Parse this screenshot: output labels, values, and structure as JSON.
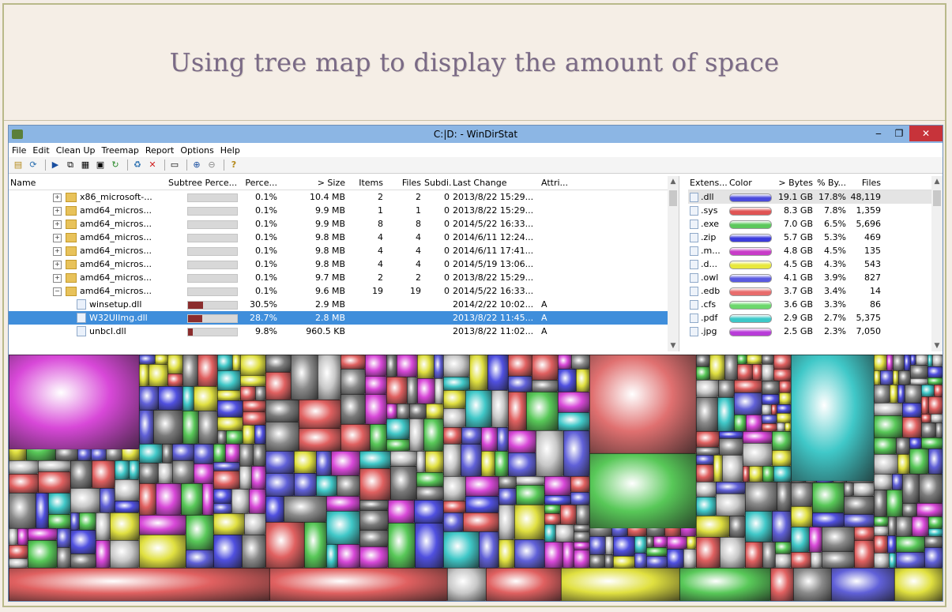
{
  "banner": {
    "title": "Using tree map to display the amount of space"
  },
  "window": {
    "title": "C:|D: - WinDirStat"
  },
  "menu": [
    "File",
    "Edit",
    "Clean Up",
    "Treemap",
    "Report",
    "Options",
    "Help"
  ],
  "tree": {
    "columns": [
      "Name",
      "Subtree Perce...",
      "Perce...",
      "> Size",
      "Items",
      "Files",
      "Subdi...",
      "Last Change",
      "Attri..."
    ],
    "rows": [
      {
        "name": "x86_microsoft-...",
        "pct": "0.1%",
        "size": "10.4 MB",
        "items": "2",
        "files": "2",
        "subdirs": "0",
        "last": "2013/8/22 15:29...",
        "attr": "",
        "type": "folder",
        "fill": 0.0
      },
      {
        "name": "amd64_micros...",
        "pct": "0.1%",
        "size": "9.9 MB",
        "items": "1",
        "files": "1",
        "subdirs": "0",
        "last": "2013/8/22 15:29...",
        "attr": "",
        "type": "folder",
        "fill": 0.0
      },
      {
        "name": "amd64_micros...",
        "pct": "0.1%",
        "size": "9.9 MB",
        "items": "8",
        "files": "8",
        "subdirs": "0",
        "last": "2014/5/22 16:33...",
        "attr": "",
        "type": "folder",
        "fill": 0.0
      },
      {
        "name": "amd64_micros...",
        "pct": "0.1%",
        "size": "9.8 MB",
        "items": "4",
        "files": "4",
        "subdirs": "0",
        "last": "2014/6/11 12:24...",
        "attr": "",
        "type": "folder",
        "fill": 0.0
      },
      {
        "name": "amd64_micros...",
        "pct": "0.1%",
        "size": "9.8 MB",
        "items": "4",
        "files": "4",
        "subdirs": "0",
        "last": "2014/6/11 17:41...",
        "attr": "",
        "type": "folder",
        "fill": 0.0
      },
      {
        "name": "amd64_micros...",
        "pct": "0.1%",
        "size": "9.8 MB",
        "items": "4",
        "files": "4",
        "subdirs": "0",
        "last": "2014/5/19 13:06...",
        "attr": "",
        "type": "folder",
        "fill": 0.0
      },
      {
        "name": "amd64_micros...",
        "pct": "0.1%",
        "size": "9.7 MB",
        "items": "2",
        "files": "2",
        "subdirs": "0",
        "last": "2013/8/22 15:29...",
        "attr": "",
        "type": "folder",
        "fill": 0.0
      },
      {
        "name": "amd64_micros...",
        "pct": "0.1%",
        "size": "9.6 MB",
        "items": "19",
        "files": "19",
        "subdirs": "0",
        "last": "2014/5/22 16:33...",
        "attr": "",
        "type": "folder",
        "fill": 0.0
      },
      {
        "name": "winsetup.dll",
        "pct": "30.5%",
        "size": "2.9 MB",
        "items": "",
        "files": "",
        "subdirs": "",
        "last": "2014/2/22 10:02...",
        "attr": "A",
        "type": "file",
        "fill": 0.305
      },
      {
        "name": "W32UIImg.dll",
        "pct": "28.7%",
        "size": "2.8 MB",
        "items": "",
        "files": "",
        "subdirs": "",
        "last": "2013/8/22 11:45...",
        "attr": "A",
        "type": "file",
        "fill": 0.287
      },
      {
        "name": "unbcl.dll",
        "pct": "9.8%",
        "size": "960.5 KB",
        "items": "",
        "files": "",
        "subdirs": "",
        "last": "2013/8/22 11:02...",
        "attr": "A",
        "type": "file",
        "fill": 0.098
      }
    ]
  },
  "extensions": {
    "columns": [
      "Extens...",
      "Color",
      "> Bytes",
      "% By...",
      "Files"
    ],
    "rows": [
      {
        "ext": ".dll",
        "color": "#4a4adc",
        "bytes": "19.1 GB",
        "pct": "17.8%",
        "files": "48,119"
      },
      {
        "ext": ".sys",
        "color": "#e05454",
        "bytes": "8.3 GB",
        "pct": "7.8%",
        "files": "1,359"
      },
      {
        "ext": ".exe",
        "color": "#5cc85c",
        "bytes": "7.0 GB",
        "pct": "6.5%",
        "files": "5,696"
      },
      {
        "ext": ".zip",
        "color": "#3c3cdc",
        "bytes": "5.7 GB",
        "pct": "5.3%",
        "files": "469"
      },
      {
        "ext": ".m...",
        "color": "#c83cc8",
        "bytes": "4.8 GB",
        "pct": "4.5%",
        "files": "135"
      },
      {
        "ext": ".d...",
        "color": "#e8e83c",
        "bytes": "4.5 GB",
        "pct": "4.3%",
        "files": "543"
      },
      {
        "ext": ".owl",
        "color": "#5a5ae0",
        "bytes": "4.1 GB",
        "pct": "3.9%",
        "files": "827"
      },
      {
        "ext": ".edb",
        "color": "#e86c6c",
        "bytes": "3.7 GB",
        "pct": "3.4%",
        "files": "14"
      },
      {
        "ext": ".cfs",
        "color": "#6cd86c",
        "bytes": "3.6 GB",
        "pct": "3.3%",
        "files": "86"
      },
      {
        "ext": ".pdf",
        "color": "#3cc8c8",
        "bytes": "2.9 GB",
        "pct": "2.7%",
        "files": "5,375"
      },
      {
        "ext": ".jpg",
        "color": "#b83cd8",
        "bytes": "2.5 GB",
        "pct": "2.3%",
        "files": "7,050"
      }
    ]
  }
}
